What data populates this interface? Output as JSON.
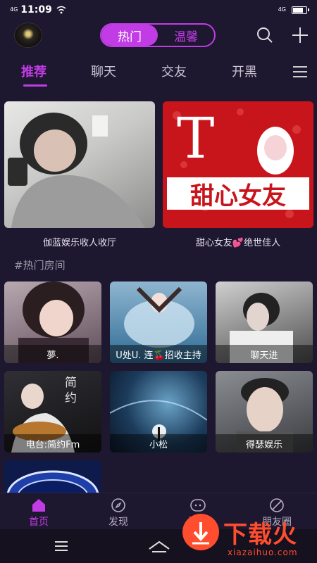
{
  "status": {
    "network": "4G",
    "time": "11:09",
    "right_network": "4G"
  },
  "header": {
    "segment": [
      "热门",
      "温馨"
    ]
  },
  "tabs": [
    "推荐",
    "聊天",
    "交友",
    "开黑"
  ],
  "featured": [
    {
      "caption": "伽蓝娱乐收人收厅"
    },
    {
      "caption": "甜心女友💕绝世佳人",
      "poster_text": "甜心女友"
    }
  ],
  "section_title": "#热门房间",
  "rooms": [
    {
      "caption": "夢."
    },
    {
      "caption": "U处U. 连🍒招收主持"
    },
    {
      "caption": "聊天进"
    },
    {
      "caption": "电台:简约Fm",
      "overlay": "简 约"
    },
    {
      "caption": "小松"
    },
    {
      "caption": "得瑟娱乐"
    },
    {
      "caption": ""
    }
  ],
  "bottom_nav": [
    {
      "label": "首页"
    },
    {
      "label": "发现"
    },
    {
      "label": "消息"
    },
    {
      "label": "朋友圈"
    }
  ],
  "watermark": {
    "title": "下载火",
    "subtitle": "xiazaihuo.com"
  },
  "colors": {
    "accent": "#c23ce6",
    "background": "#1e1730"
  }
}
